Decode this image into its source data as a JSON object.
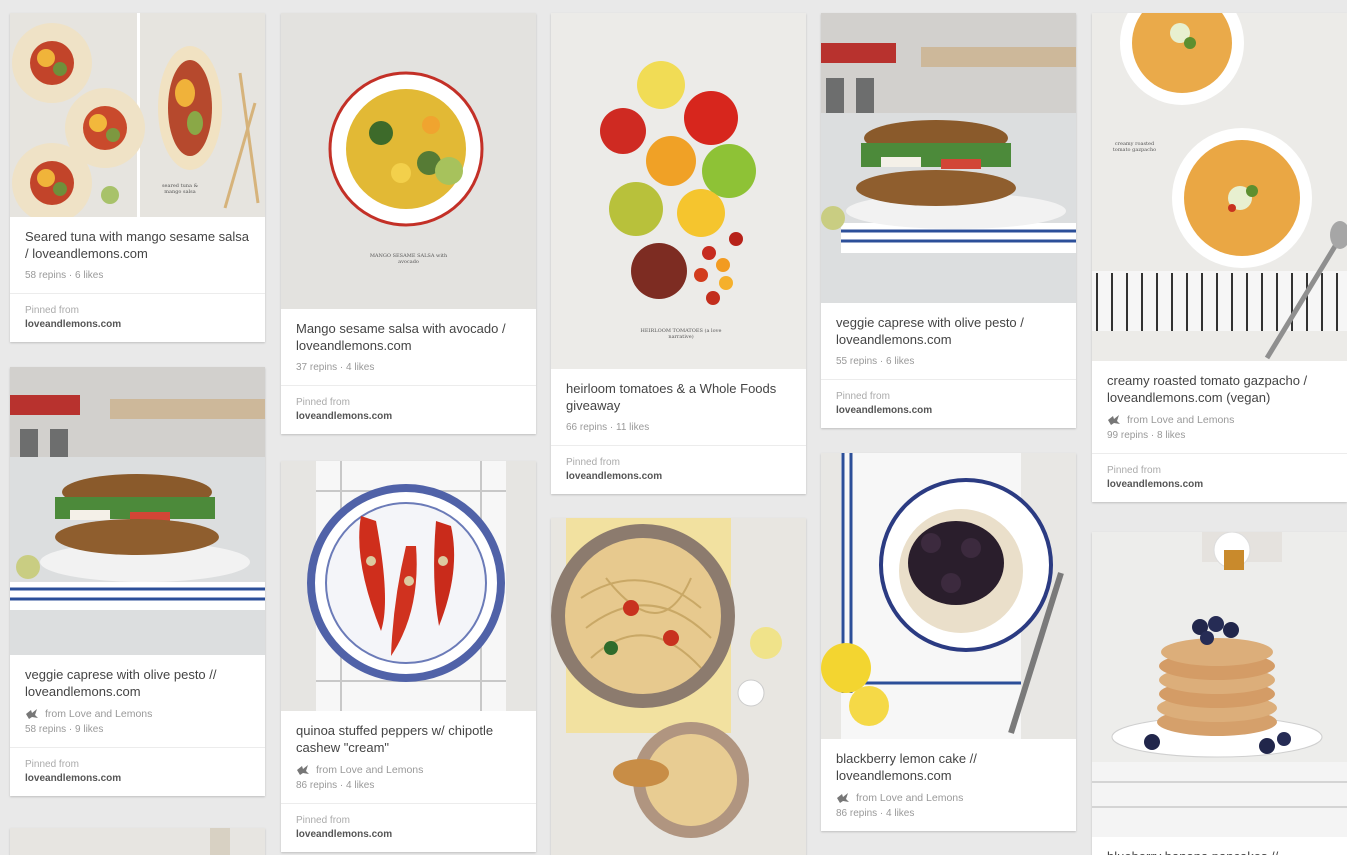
{
  "brand_colors": {
    "background": "#e9e9e9",
    "card": "#ffffff",
    "text": "#444444",
    "meta": "#999999"
  },
  "pins": [
    {
      "description": "Seared tuna with mango sesame salsa / loveandlemons.com",
      "via": "",
      "stats": "58 repins · 6 likes",
      "pinned_from_label": "Pinned from",
      "pinned_from_domain": "loveandlemons.com",
      "image_caption": "seared tuna & mango salsa"
    },
    {
      "description": "veggie caprese with olive pesto // loveandlemons.com",
      "via": "from Love and Lemons",
      "stats": "58 repins · 9 likes",
      "pinned_from_label": "Pinned from",
      "pinned_from_domain": "loveandlemons.com"
    },
    {
      "description": "Mango sesame salsa with avocado / loveandlemons.com",
      "via": "",
      "stats": "37 repins · 4 likes",
      "pinned_from_label": "Pinned from",
      "pinned_from_domain": "loveandlemons.com",
      "image_caption": "MANGO SESAME SALSA with avocado"
    },
    {
      "description": "quinoa stuffed peppers w/ chipotle cashew \"cream\"",
      "via": "from Love and Lemons",
      "stats": "86 repins · 4 likes",
      "pinned_from_label": "Pinned from",
      "pinned_from_domain": "loveandlemons.com"
    },
    {
      "description": "heirloom tomatoes & a Whole Foods giveaway",
      "via": "",
      "stats": "66 repins · 11 likes",
      "pinned_from_label": "Pinned from",
      "pinned_from_domain": "loveandlemons.com",
      "image_caption": "HEIRLOOM TOMATOES (a love narrative)"
    },
    {
      "description": "veggie caprese with olive pesto / loveandlemons.com",
      "via": "",
      "stats": "55 repins · 6 likes",
      "pinned_from_label": "Pinned from",
      "pinned_from_domain": "loveandlemons.com"
    },
    {
      "description": "blackberry lemon cake // loveandlemons.com",
      "via": "from Love and Lemons",
      "stats": "86 repins · 4 likes",
      "pinned_from_label": "",
      "pinned_from_domain": ""
    },
    {
      "description": "creamy roasted tomato gazpacho / loveandlemons.com (vegan)",
      "via": "from Love and Lemons",
      "stats": "99 repins · 8 likes",
      "pinned_from_label": "Pinned from",
      "pinned_from_domain": "loveandlemons.com",
      "image_caption": "creamy roasted tomato gazpacho"
    },
    {
      "description": "blueberry banana pancakes // loveandlemons.com",
      "via": "",
      "stats": "",
      "pinned_from_label": "",
      "pinned_from_domain": ""
    }
  ]
}
